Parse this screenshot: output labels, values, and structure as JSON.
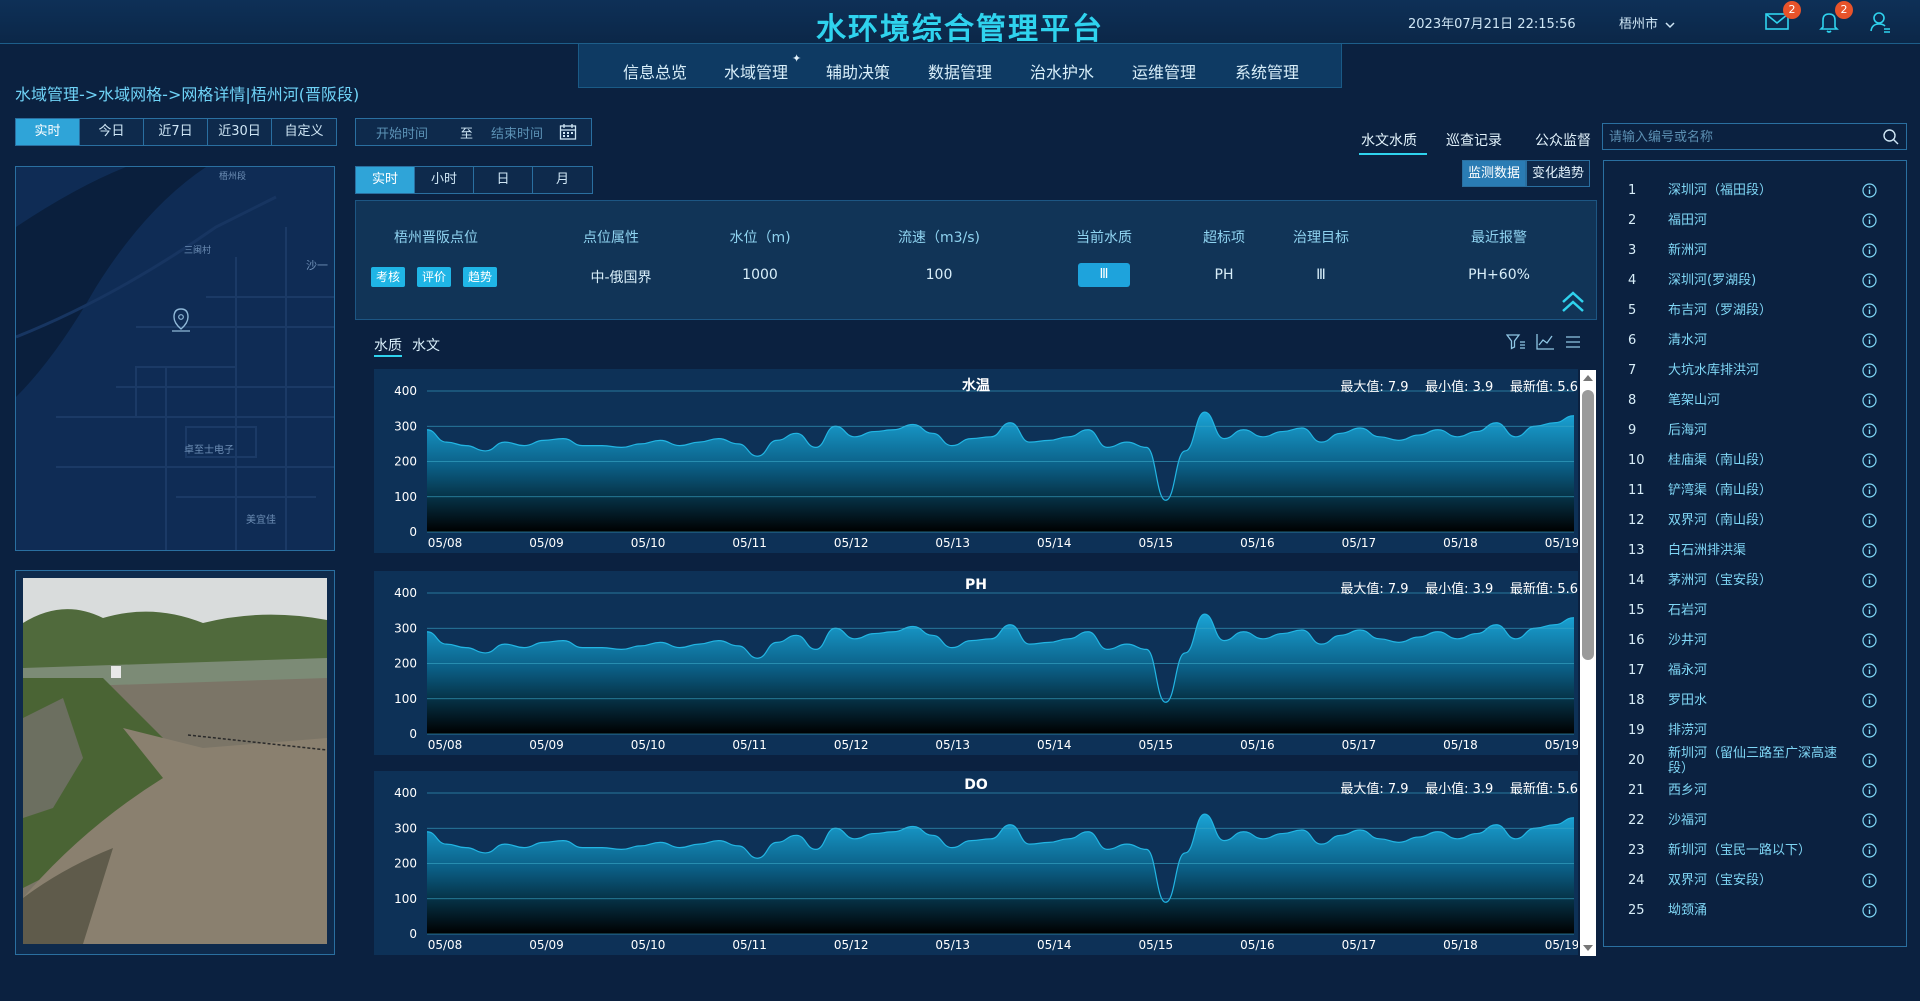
{
  "header": {
    "title": "水环境综合管理平台",
    "datetime": "2023年07月21日 22:15:56",
    "city": "梧州市",
    "mail_badge": "2",
    "bell_badge": "2"
  },
  "nav": {
    "items": [
      {
        "label": "信息总览"
      },
      {
        "label": "水域管理"
      },
      {
        "label": "辅助决策"
      },
      {
        "label": "数据管理"
      },
      {
        "label": "治水护水"
      },
      {
        "label": "运维管理"
      },
      {
        "label": "系统管理"
      }
    ]
  },
  "breadcrumb": "水域管理->水域网格->网格详情|梧州河(晋阪段)",
  "time_range": {
    "buttons": [
      "实时",
      "今日",
      "近7日",
      "近30日",
      "自定义"
    ],
    "active": 0
  },
  "date_range": {
    "start_placeholder": "开始时间",
    "separator": "至",
    "end_placeholder": "结束时间"
  },
  "granularity": {
    "buttons": [
      "实时",
      "小时",
      "日",
      "月"
    ],
    "active": 0
  },
  "map": {
    "labels": [
      "梧州段",
      "三闽村",
      "沙一",
      "卓至士电子",
      "美宜佳"
    ]
  },
  "right_tabs": [
    "水文水质",
    "巡查记录",
    "公众监督"
  ],
  "search": {
    "placeholder": "请输入编号或名称"
  },
  "sub_tabs": [
    "监测数据",
    "变化趋势"
  ],
  "info_table": {
    "headers": [
      "梧州晋阪点位",
      "点位属性",
      "水位（m)",
      "流速（m3/s)",
      "当前水质",
      "超标项",
      "治理目标",
      "最近报警"
    ],
    "tags": [
      "考核",
      "评价",
      "趋势"
    ],
    "values": {
      "attribute": "中-俄国界",
      "water_level": "1000",
      "flow_rate": "100",
      "quality": "Ⅲ",
      "exceed": "PH",
      "target": "Ⅲ",
      "alarm": "PH+60%"
    }
  },
  "chart_tabs": [
    "水质",
    "水文"
  ],
  "charts": [
    {
      "name": "水温",
      "max_label": "最大值: 7.9",
      "min_label": "最小值: 3.9",
      "latest_label": "最新值: 5.6"
    },
    {
      "name": "PH",
      "max_label": "最大值: 7.9",
      "min_label": "最小值: 3.9",
      "latest_label": "最新值: 5.6"
    },
    {
      "name": "DO",
      "max_label": "最大值: 7.9",
      "min_label": "最小值: 3.9",
      "latest_label": "最新值: 5.6"
    }
  ],
  "chart_data": [
    {
      "type": "area",
      "title": "水温",
      "x": [
        "05/08",
        "05/09",
        "05/10",
        "05/11",
        "05/12",
        "05/13",
        "05/14",
        "05/15",
        "05/16",
        "05/17",
        "05/18",
        "05/19"
      ],
      "ylim": [
        0,
        400
      ],
      "yticks": [
        0,
        100,
        200,
        300,
        400
      ],
      "series": [
        {
          "values": [
            290,
            255,
            245,
            230,
            255,
            245,
            260,
            265,
            245,
            245,
            240,
            250,
            260,
            245,
            255,
            265,
            250,
            215,
            260,
            280,
            240,
            300,
            270,
            285,
            290,
            305,
            280,
            245,
            265,
            270,
            310,
            255,
            260,
            270,
            290,
            240,
            255,
            240,
            90,
            230,
            340,
            265,
            290,
            270,
            285,
            295,
            255,
            280,
            295,
            270,
            260,
            275,
            290,
            270,
            285,
            310,
            270,
            300,
            310,
            330
          ]
        }
      ]
    },
    {
      "type": "area",
      "title": "PH",
      "x": [
        "05/08",
        "05/09",
        "05/10",
        "05/11",
        "05/12",
        "05/13",
        "05/14",
        "05/15",
        "05/16",
        "05/17",
        "05/18",
        "05/19"
      ],
      "ylim": [
        0,
        400
      ],
      "yticks": [
        0,
        100,
        200,
        300,
        400
      ],
      "series": [
        {
          "values": [
            290,
            255,
            245,
            230,
            255,
            245,
            260,
            265,
            245,
            245,
            240,
            250,
            260,
            245,
            255,
            265,
            250,
            215,
            260,
            280,
            240,
            300,
            270,
            285,
            290,
            305,
            280,
            245,
            265,
            270,
            310,
            255,
            260,
            270,
            290,
            240,
            255,
            240,
            90,
            230,
            340,
            265,
            290,
            270,
            285,
            295,
            255,
            280,
            295,
            270,
            260,
            275,
            290,
            270,
            285,
            310,
            270,
            300,
            310,
            330
          ]
        }
      ]
    },
    {
      "type": "area",
      "title": "DO",
      "x": [
        "05/08",
        "05/09",
        "05/10",
        "05/11",
        "05/12",
        "05/13",
        "05/14",
        "05/15",
        "05/16",
        "05/17",
        "05/18",
        "05/19"
      ],
      "ylim": [
        0,
        400
      ],
      "yticks": [
        0,
        100,
        200,
        300,
        400
      ],
      "series": [
        {
          "values": [
            290,
            255,
            245,
            230,
            255,
            245,
            260,
            265,
            245,
            245,
            240,
            250,
            260,
            245,
            255,
            265,
            250,
            215,
            260,
            280,
            240,
            300,
            270,
            285,
            290,
            305,
            280,
            245,
            265,
            270,
            310,
            255,
            260,
            270,
            290,
            240,
            255,
            240,
            90,
            230,
            340,
            265,
            290,
            270,
            285,
            295,
            255,
            280,
            295,
            270,
            260,
            275,
            290,
            270,
            285,
            310,
            270,
            300,
            310,
            330
          ]
        }
      ]
    }
  ],
  "river_list": [
    {
      "num": "1",
      "name": "深圳河（福田段）"
    },
    {
      "num": "2",
      "name": "福田河"
    },
    {
      "num": "3",
      "name": "新洲河"
    },
    {
      "num": "4",
      "name": "深圳河(罗湖段)"
    },
    {
      "num": "5",
      "name": "布吉河（罗湖段）"
    },
    {
      "num": "6",
      "name": "清水河"
    },
    {
      "num": "7",
      "name": "大坑水库排洪河"
    },
    {
      "num": "8",
      "name": "笔架山河"
    },
    {
      "num": "9",
      "name": "后海河"
    },
    {
      "num": "10",
      "name": "桂庙渠（南山段）"
    },
    {
      "num": "11",
      "name": "铲湾渠（南山段）"
    },
    {
      "num": "12",
      "name": "双界河（南山段）"
    },
    {
      "num": "13",
      "name": "白石洲排洪渠"
    },
    {
      "num": "14",
      "name": "茅洲河（宝安段）"
    },
    {
      "num": "15",
      "name": "石岩河"
    },
    {
      "num": "16",
      "name": "沙井河"
    },
    {
      "num": "17",
      "name": "福永河"
    },
    {
      "num": "18",
      "name": "罗田水"
    },
    {
      "num": "19",
      "name": "排涝河"
    },
    {
      "num": "20",
      "name": "新圳河（留仙三路至广深高速段）"
    },
    {
      "num": "21",
      "name": "西乡河"
    },
    {
      "num": "22",
      "name": "沙福河"
    },
    {
      "num": "23",
      "name": "新圳河（宝民一路以下）"
    },
    {
      "num": "24",
      "name": "双界河（宝安段）"
    },
    {
      "num": "25",
      "name": "坳颈涌"
    }
  ],
  "colors": {
    "accent": "#2fd3ee",
    "active_button": "#2fa4d8",
    "panel": "#0d3157",
    "badge": "#e8532a"
  }
}
